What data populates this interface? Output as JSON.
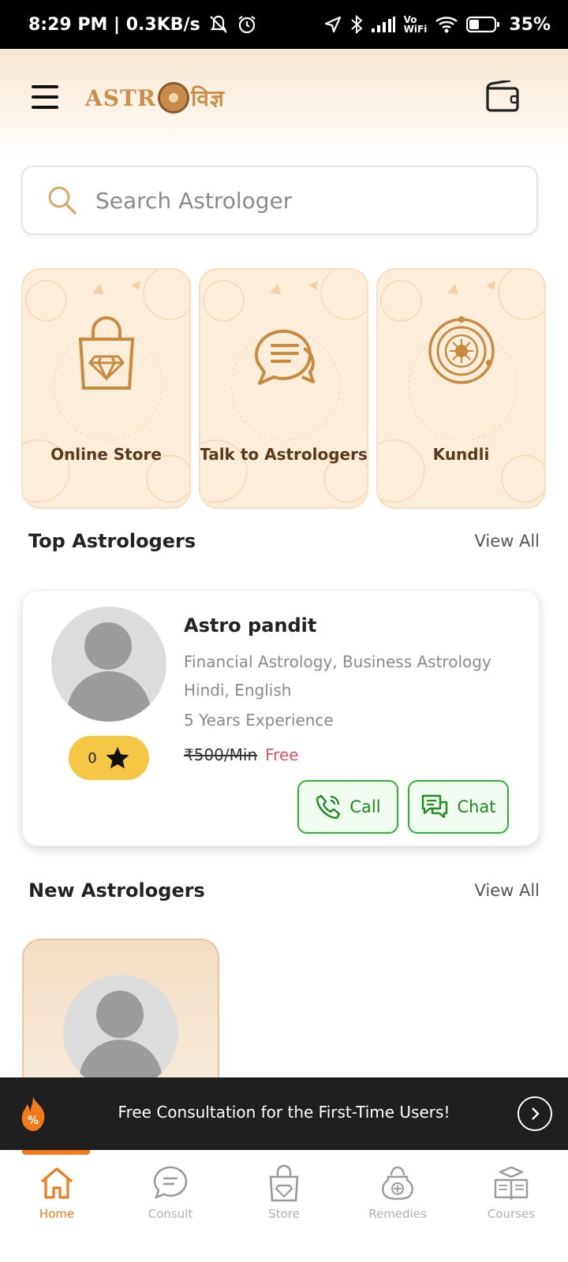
{
  "status_bar": {
    "time_speed": "8:29 PM | 0.3KB/s",
    "vowifi_top": "Vo",
    "vowifi_bottom": "WiFi",
    "battery": "35%"
  },
  "header": {
    "logo_text": "ASTR",
    "logo_suffix": "विज्ञ",
    "menu_icon": "hamburger-menu-icon",
    "wallet_icon": "wallet-icon"
  },
  "search": {
    "placeholder": "Search Astrologer",
    "icon": "search-icon"
  },
  "feature_cards": [
    {
      "label": "Online Store",
      "icon": "shopping-bag-diamond-icon"
    },
    {
      "label": "Talk to Astrologers",
      "icon": "chat-bubbles-icon"
    },
    {
      "label": "Kundli",
      "icon": "zodiac-wheel-icon"
    }
  ],
  "top_astrologers": {
    "title": "Top Astrologers",
    "view_all": "View All",
    "card": {
      "name": "Astro pandit",
      "specialties": "Financial Astrology, Business Astrology",
      "languages": "Hindi, English",
      "experience": "5 Years Experience",
      "rating": "0",
      "price_old": "₹500/Min",
      "price_new": "Free",
      "call_label": "Call",
      "chat_label": "Chat"
    }
  },
  "new_astrologers": {
    "title": "New Astrologers",
    "view_all": "View All"
  },
  "promo": {
    "text": "Free Consultation for the First-Time Users!",
    "badge": "%"
  },
  "bottom_nav": {
    "items": [
      {
        "label": "Home",
        "icon": "home-icon",
        "active": true
      },
      {
        "label": "Consult",
        "icon": "consult-chat-icon",
        "active": false
      },
      {
        "label": "Store",
        "icon": "store-bag-icon",
        "active": false
      },
      {
        "label": "Remedies",
        "icon": "remedies-kalash-icon",
        "active": false
      },
      {
        "label": "Courses",
        "icon": "courses-book-icon",
        "active": false
      }
    ]
  },
  "colors": {
    "accent": "#f07a1e",
    "brand_gold": "#cf8e45",
    "card_bg": "#fdeedb",
    "action_green": "#2eb52e",
    "rating_yellow": "#f6c744",
    "free_red": "#e0566b"
  }
}
